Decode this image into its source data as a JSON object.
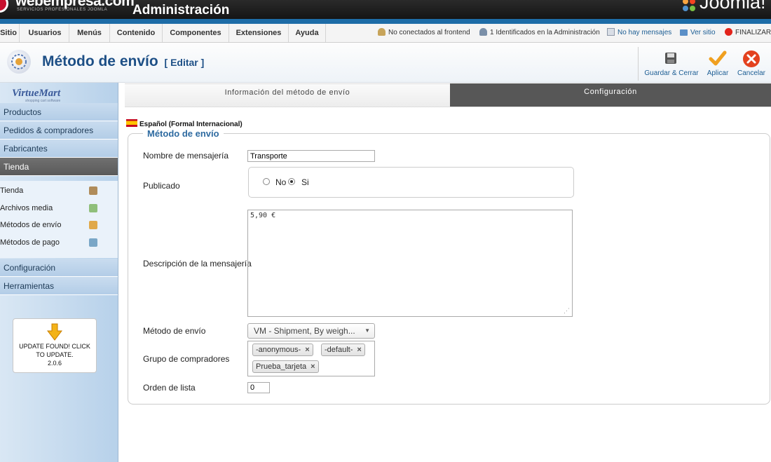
{
  "header": {
    "brand": "webempresa.com",
    "brand_sub": "SERVICIOS PROFESIONALES JOOMLA",
    "admin_title": "Administración",
    "joomla_label": "Joomla!"
  },
  "menu": {
    "items": [
      "Sitio",
      "Usuarios",
      "Menús",
      "Contenido",
      "Componentes",
      "Extensiones",
      "Ayuda"
    ],
    "status": {
      "frontend": "No conectados al frontend",
      "admin": "1 Identificados en la Administración",
      "messages": "No hay mensajes",
      "view_site": "Ver sitio",
      "logout": "FINALIZAR"
    }
  },
  "toolbar": {
    "title": "Método de envío",
    "subtitle": "[ Editar ]",
    "save_close": "Guardar & Cerrar",
    "apply": "Aplicar",
    "cancel": "Cancelar"
  },
  "sidebar": {
    "logo": "VirtueMart",
    "logo_sub": "shopping cart software",
    "sections": [
      "Productos",
      "Pedidos & compradores",
      "Fabricantes",
      "Tienda"
    ],
    "sub_items": [
      "Tienda",
      "Archivos media",
      "Métodos de envío",
      "Métodos de pago"
    ],
    "bottom_sections": [
      "Configuración",
      "Herramientas"
    ],
    "update_line1": "UPDATE FOUND! CLICK",
    "update_line2": "TO UPDATE.",
    "update_version": "2.0.6"
  },
  "tabs": {
    "info": "Información del método de envío",
    "config": "Configuración"
  },
  "form": {
    "language": "Español (Formal Internacional)",
    "legend": "Método de envío",
    "name_label": "Nombre de mensajería",
    "name_value": "Transporte",
    "published_label": "Publicado",
    "published_no": "No",
    "published_yes": "Si",
    "published_selected": "Si",
    "description_label": "Descripción de la mensajería",
    "description_value": "5,90 €",
    "method_label": "Método de envío",
    "method_value": "VM - Shipment, By weigh...",
    "group_label": "Grupo de compradores",
    "groups": [
      "-anonymous-",
      "-default-",
      "Prueba_tarjeta"
    ],
    "order_label": "Orden de lista",
    "order_value": "0"
  },
  "colors": {
    "header_dark": "#1c1c1c",
    "header_blue": "#1d6ca7",
    "title_blue": "#1d4f86",
    "active_tab": "#575757",
    "sidebar_active": "#5f5f5f"
  }
}
